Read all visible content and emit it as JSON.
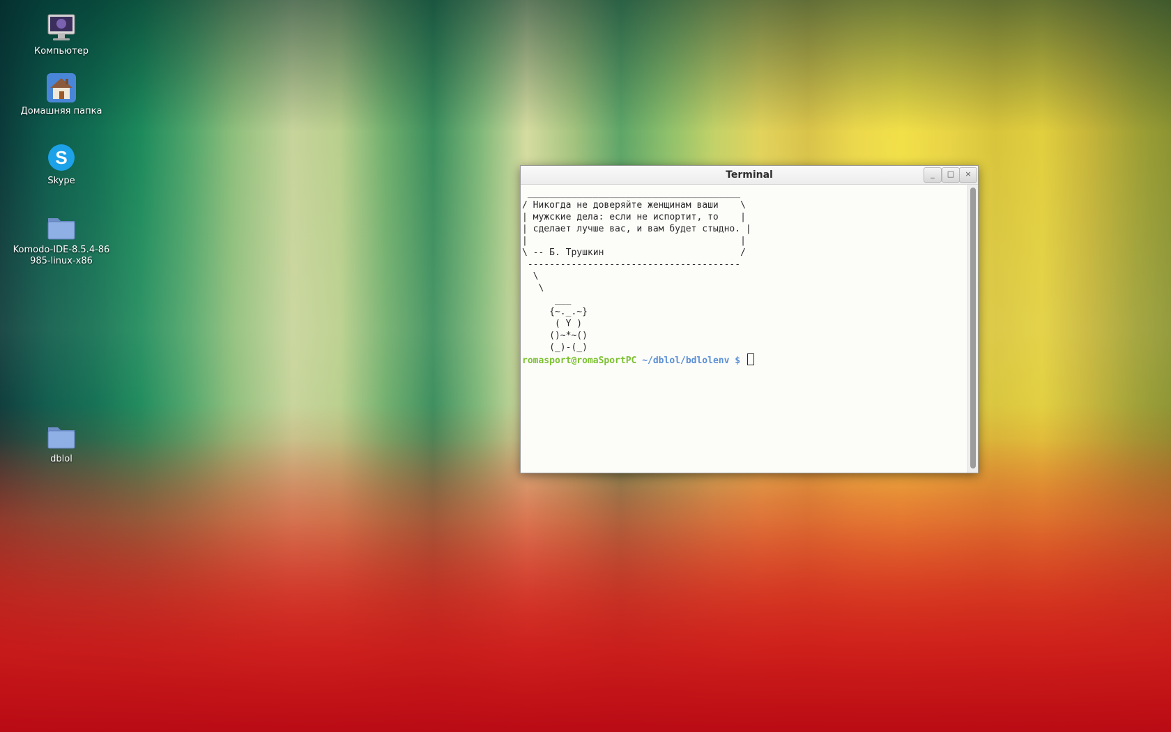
{
  "desktop": {
    "icons": [
      {
        "label": "Компьютер",
        "icon": "computer-icon"
      },
      {
        "label": "Домашняя папка",
        "icon": "home-folder-icon"
      },
      {
        "label": "Skype",
        "icon": "skype-icon"
      },
      {
        "label": "Komodo-IDE-8.5.4-86985-linux-x86",
        "icon": "folder-icon"
      },
      {
        "label": "dblol",
        "icon": "folder-icon"
      }
    ]
  },
  "terminal": {
    "title": "Terminal",
    "buttons": {
      "minimize": "_",
      "maximize": "□",
      "close": "×"
    },
    "output": " _______________________________________\n/ Никогда не доверяйте женщинам ваши    \\\n| мужские дела: если не испортит, то    |\n| сделает лучше вас, и вам будет стыдно. |\n|                                       |\n\\ -- Б. Трушкин                         /\n ---------------------------------------\n  \\\n   \\\n      ___\n     {~._.~}\n      ( Y )\n     ()~*~()\n     (_)-(_)",
    "prompt": {
      "user_host": "romasport@romaSportPC",
      "path": " ~/dblol/bdlolenv",
      "symbol": " $ "
    }
  },
  "colors": {
    "prompt_user": "#7cc130",
    "prompt_path": "#5a8fd6",
    "terminal_bg": "#fcfcf9"
  }
}
